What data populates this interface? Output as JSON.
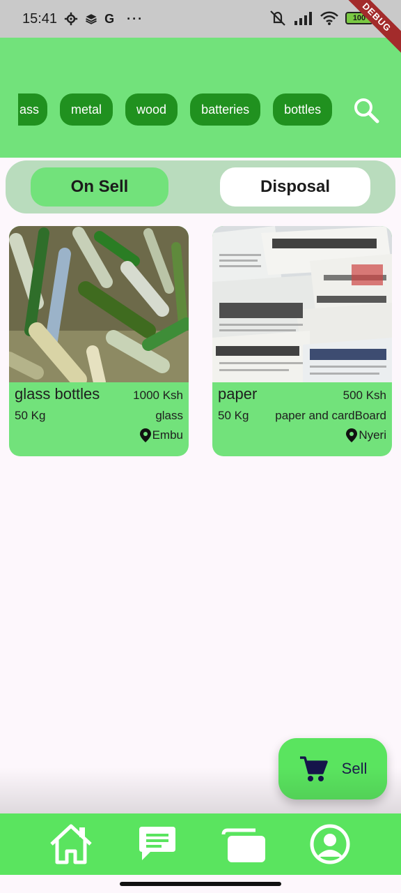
{
  "status_bar": {
    "time": "15:41",
    "left_icons": [
      "gear-icon",
      "layers-icon",
      "google-icon",
      "more-icon"
    ],
    "google_letter": "G",
    "more": "···",
    "battery": "100",
    "debug": "DEBUG"
  },
  "categories": [
    {
      "label": "ass"
    },
    {
      "label": "metal"
    },
    {
      "label": "wood"
    },
    {
      "label": "batteries"
    },
    {
      "label": "bottles"
    }
  ],
  "toggle": {
    "active": "On Sell",
    "inactive": "Disposal"
  },
  "listings": [
    {
      "title": "glass bottles",
      "price": "1000 Ksh",
      "weight": "50 Kg",
      "category": "glass",
      "location": "Embu",
      "image": "glass-bottles-photo"
    },
    {
      "title": "paper",
      "price": "500 Ksh",
      "weight": "50 Kg",
      "category": "paper and cardBoard",
      "location": "Nyeri",
      "image": "newspapers-photo"
    }
  ],
  "fab": {
    "label": "Sell",
    "icon": "cart-icon"
  },
  "bottom_nav": [
    "home-icon",
    "chat-icon",
    "cards-icon",
    "profile-icon"
  ],
  "colors": {
    "header": "#72e27b",
    "chip": "#20911f",
    "card": "#72e27b",
    "nav": "#5ae45f"
  }
}
